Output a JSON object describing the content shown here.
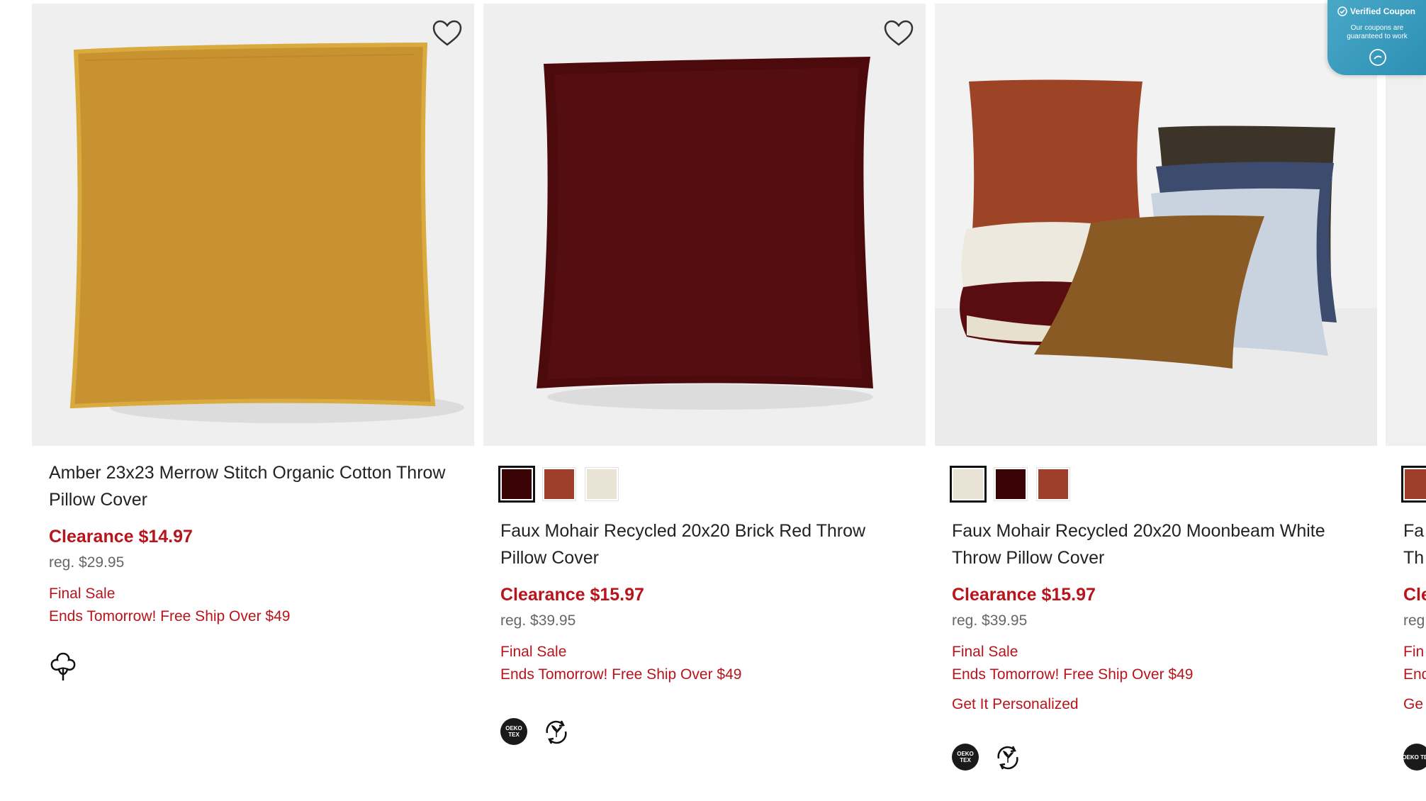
{
  "coupon": {
    "title": "Verified Coupon",
    "subtitle": "Our coupons are guaranteed to work"
  },
  "products": [
    {
      "title": "Amber 23x23 Merrow Stitch Organic Cotton Throw Pillow Cover",
      "price": "Clearance $14.97",
      "reg": "reg. $29.95",
      "final_sale": "Final Sale",
      "promo": "Ends Tomorrow! Free Ship Over $49",
      "icons": [
        "organic-cotton-icon"
      ],
      "swatches": []
    },
    {
      "title": "Faux Mohair Recycled 20x20 Brick Red Throw Pillow Cover",
      "price": "Clearance $15.97",
      "reg": "reg. $39.95",
      "final_sale": "Final Sale",
      "promo": "Ends Tomorrow! Free Ship Over $49",
      "icons": [
        "oeko-tex-icon",
        "recycled-icon"
      ],
      "badge_text": "OEKO TEX",
      "swatches": [
        {
          "color": "#3a0406",
          "selected": true
        },
        {
          "color": "#9e3f2b",
          "selected": false
        },
        {
          "color": "#e9e3d6",
          "selected": false
        }
      ]
    },
    {
      "title": "Faux Mohair Recycled 20x20 Moonbeam White Throw Pillow Cover",
      "price": "Clearance $15.97",
      "reg": "reg. $39.95",
      "final_sale": "Final Sale",
      "promo": "Ends Tomorrow! Free Ship Over $49",
      "personalize": "Get It Personalized",
      "icons": [
        "oeko-tex-icon",
        "recycled-icon"
      ],
      "badge_text": "OEKO TEX",
      "swatches": [
        {
          "color": "#e9e3d6",
          "selected": true
        },
        {
          "color": "#3a0406",
          "selected": false
        },
        {
          "color": "#9e3f2b",
          "selected": false
        }
      ]
    },
    {
      "title_peek": "Fa",
      "title_peek_2": "Th",
      "price_peek": "Cle",
      "reg_peek": "reg",
      "final_peek": "Fin",
      "promo_peek": "End",
      "personalize_peek": "Ge",
      "badge_text": "OEKO TEX"
    }
  ],
  "colors": {
    "accent_red": "#b8141b",
    "coupon_blue": "#3a9dc2",
    "image_bg": "#f0f0f0"
  }
}
